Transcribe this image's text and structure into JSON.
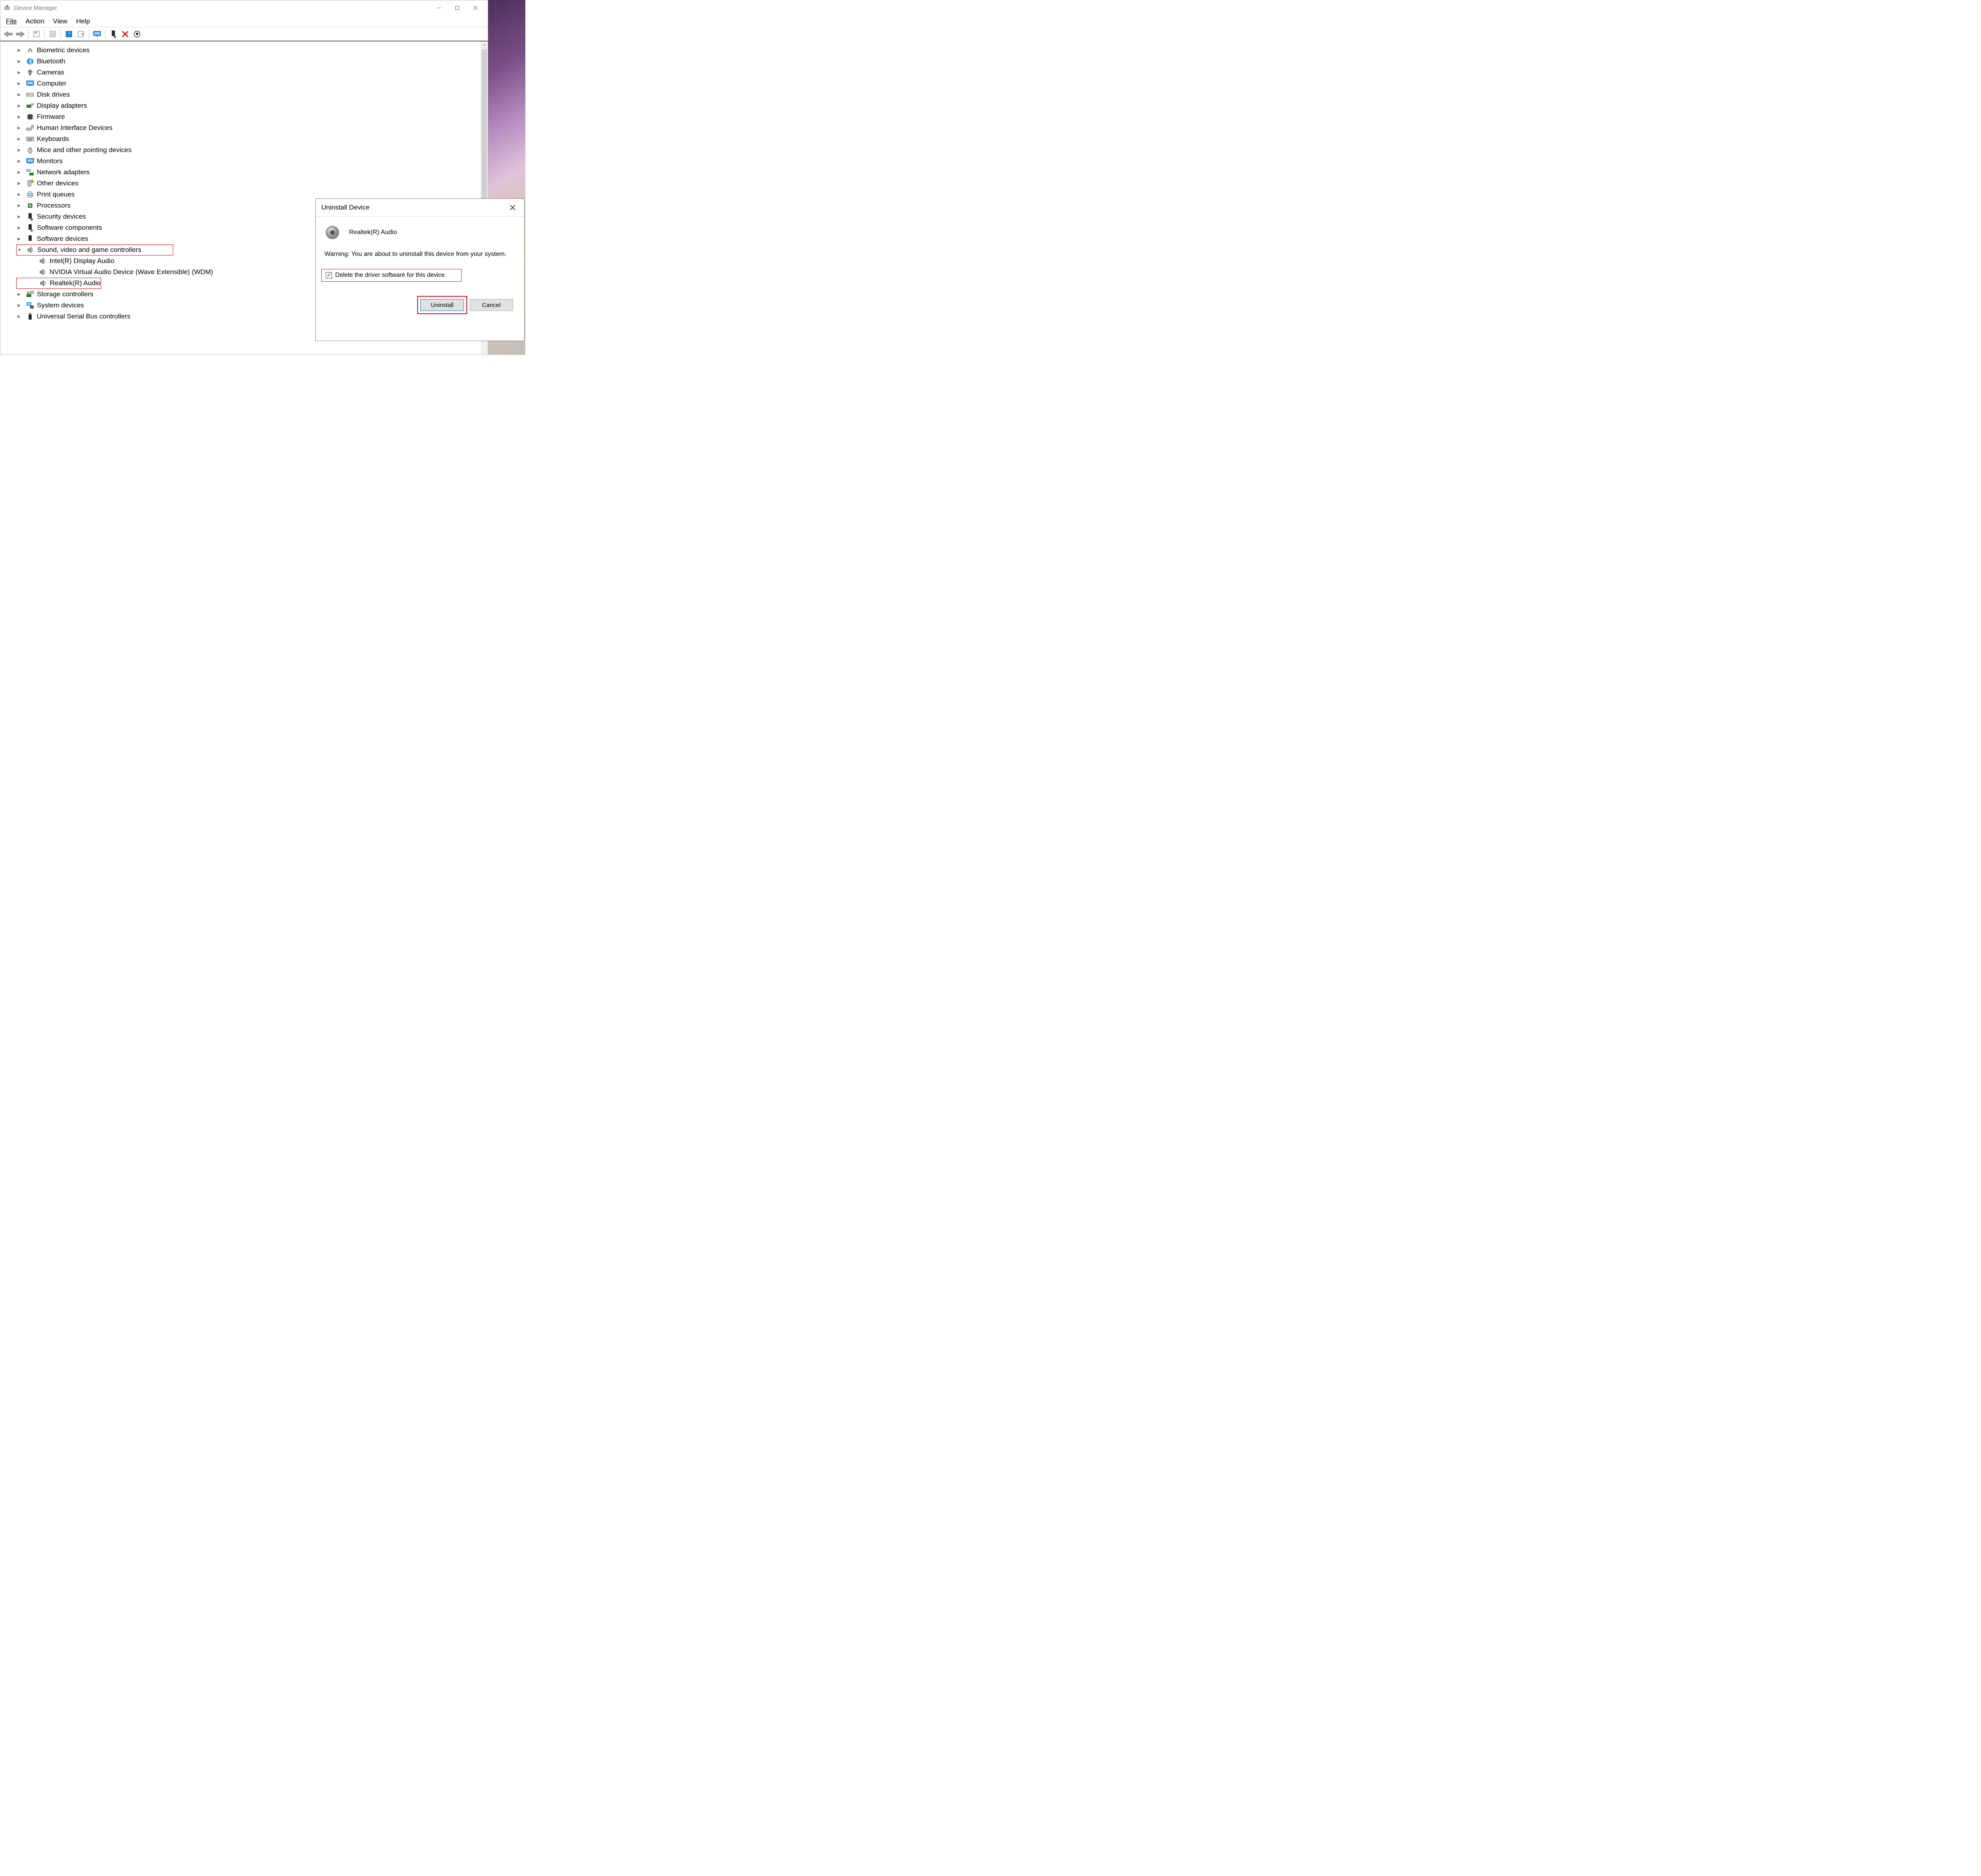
{
  "window": {
    "title": "Device Manager"
  },
  "menu": {
    "file": "File",
    "action": "Action",
    "view": "View",
    "help": "Help"
  },
  "toolbar": {
    "back": "back",
    "forward": "forward",
    "properties": "properties",
    "hwids": "hwids",
    "help": "help",
    "scan": "scan",
    "monitor": "monitor",
    "enable": "enable",
    "disable": "disable",
    "uninstall": "uninstall"
  },
  "tree": {
    "biometric": "Biometric devices",
    "bluetooth": "Bluetooth",
    "cameras": "Cameras",
    "computer": "Computer",
    "disk": "Disk drives",
    "display": "Display adapters",
    "firmware": "Firmware",
    "hid": "Human Interface Devices",
    "keyboards": "Keyboards",
    "mice": "Mice and other pointing devices",
    "monitors": "Monitors",
    "network": "Network adapters",
    "other": "Other devices",
    "printq": "Print queues",
    "processors": "Processors",
    "security": "Security devices",
    "swcomp": "Software components",
    "swdev": "Software devices",
    "sound": "Sound, video and game controllers",
    "sound_children": {
      "intel": "Intel(R) Display Audio",
      "nvidia": "NVIDIA Virtual Audio Device (Wave Extensible) (WDM)",
      "realtek": "Realtek(R) Audio"
    },
    "storage": "Storage controllers",
    "sysdev": "System devices",
    "usb": "Universal Serial Bus controllers"
  },
  "dialog": {
    "title": "Uninstall Device",
    "device_name": "Realtek(R) Audio",
    "warning": "Warning: You are about to uninstall this device from your system.",
    "checkbox_label": "Delete the driver software for this device.",
    "checkbox_checked": true,
    "btn_uninstall": "Uninstall",
    "btn_cancel": "Cancel"
  }
}
